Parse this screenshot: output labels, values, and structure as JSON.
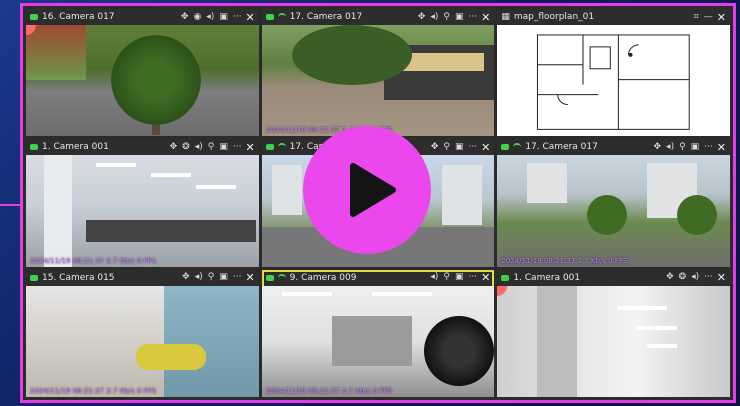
{
  "accent_color": "#e53de5",
  "play_color": "#ea48ec",
  "tiles": [
    {
      "title": "16. Camera 017",
      "tools": [
        "ptz-icon",
        "record-icon",
        "volume-icon",
        "camera-icon",
        "more-icon"
      ],
      "overlay": "",
      "selected": false
    },
    {
      "title": "17. Camera 017",
      "tools": [
        "ptz-icon",
        "volume-icon",
        "zoom-icon",
        "camera-icon",
        "more-icon"
      ],
      "overlay": "2024/11/19 08:21:37 2.7 Kb/s 0 FPS",
      "selected": false
    },
    {
      "title": "map_floorplan_01",
      "tools": [
        "map-icon",
        "minus-icon"
      ],
      "overlay": "",
      "selected": false
    },
    {
      "title": "1. Camera 001",
      "tools": [
        "ptz-icon",
        "fisheye-icon",
        "volume-icon",
        "zoom-icon",
        "camera-icon",
        "more-icon"
      ],
      "overlay": "2024/11/19 08:21:37 2.7 Kb/s 0 FPS",
      "selected": false
    },
    {
      "title": "17. Camera 017",
      "tools": [
        "ptz-icon",
        "zoom-icon",
        "camera-icon",
        "more-icon"
      ],
      "overlay": "",
      "selected": false
    },
    {
      "title": "17. Camera 017",
      "tools": [
        "ptz-icon",
        "volume-icon",
        "zoom-icon",
        "camera-icon",
        "more-icon"
      ],
      "overlay": "2024/11/19 08:21:37 2.7 Kb/s 0 FPS",
      "selected": false
    },
    {
      "title": "15. Camera 015",
      "tools": [
        "ptz-icon",
        "volume-icon",
        "zoom-icon",
        "camera-icon",
        "more-icon"
      ],
      "overlay": "2024/11/19 08:21:37 2.7 Kb/s 0 FPS",
      "selected": false
    },
    {
      "title": "9. Camera 009",
      "tools": [
        "volume-icon",
        "zoom-icon",
        "camera-icon",
        "more-icon"
      ],
      "overlay": "2024/11/19 08:21:37 2.7 Kb/s 0 FPS",
      "selected": true
    },
    {
      "title": "1. Camera 001",
      "tools": [
        "ptz-icon",
        "fisheye-icon",
        "volume-icon",
        "more-icon"
      ],
      "overlay": "",
      "selected": false
    }
  ]
}
